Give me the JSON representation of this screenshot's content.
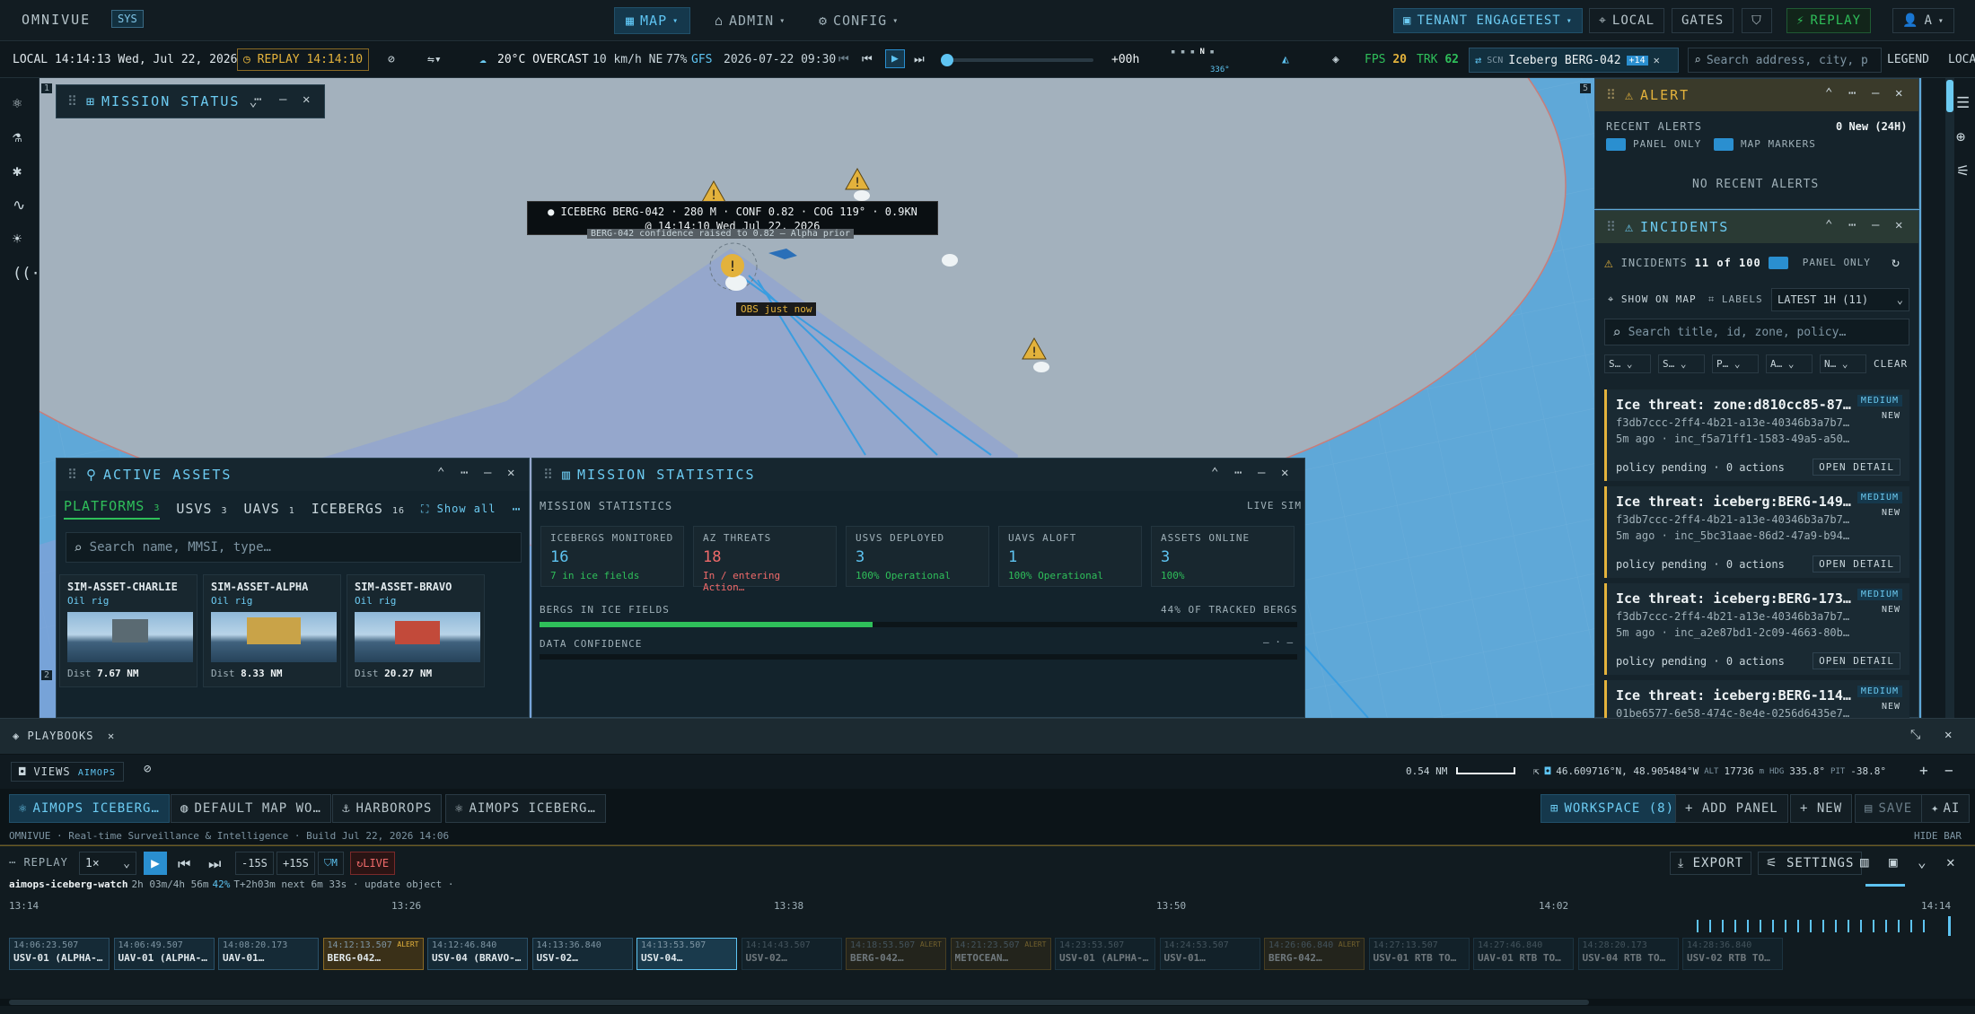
{
  "brand": "OMNIVUE",
  "sys_badge": "SYS",
  "nav": {
    "tabs": [
      "MAP",
      "ADMIN",
      "CONFIG"
    ],
    "tenant": "TENANT ENGAGETEST",
    "local": "LOCAL",
    "gates": "GATES",
    "replay": "REPLAY",
    "user": "A"
  },
  "toolbar": {
    "local_time": "LOCAL 14:14:13 Wed, Jul 22, 2026",
    "replay_time": "REPLAY 14:14:10",
    "weather": "20°C OVERCAST",
    "wind": "10 km/h NE",
    "humidity": "77%",
    "gfs": "GFS",
    "gfs_time": "2026-07-22 09:30",
    "offset": "+00h",
    "compass": {
      "n": "N",
      "deg": "336°"
    },
    "fps_label": "FPS",
    "fps": "20",
    "trk_label": "TRK",
    "trk": "62",
    "scn_label": "SCN",
    "scn": "Iceberg BERG-042",
    "scn_more": "+14",
    "search_placeholder": "Search address, city, p",
    "legend": "LEGEND",
    "loc": "LOCA"
  },
  "map": {
    "tooltip_line1": "● ICEBERG BERG-042 · 280 M · CONF 0.82 · COG 119° · 0.9KN",
    "tooltip_line2": "@ 14:14:10 Wed Jul 22, 2026",
    "note": "BERG-042 confidence raised to 0.82 — Alpha prior",
    "obs": "OBS just now",
    "scale_label": "0.54 NM",
    "coords": "46.609716°N, 48.905484°W",
    "alt_label": "ALT",
    "alt": "17736",
    "alt_unit": "m",
    "hdg_label": "HDG",
    "hdg": "335.8°",
    "pit_label": "PIT",
    "pit": "-38.8°",
    "views": "VIEWS",
    "aimops": "AIMOPS",
    "corner_left_top": "1",
    "corner_left_bottom": "2",
    "corner_right_top": "5"
  },
  "mission_status": {
    "title": "MISSION STATUS"
  },
  "assets": {
    "title": "ACTIVE ASSETS",
    "tabs": [
      {
        "label": "PLATFORMS",
        "count": "3"
      },
      {
        "label": "USVS",
        "count": "3"
      },
      {
        "label": "UAVS",
        "count": "1"
      },
      {
        "label": "ICEBERGS",
        "count": "16"
      }
    ],
    "show_all": "Show all",
    "search_placeholder": "Search name, MMSI, type…",
    "cards": [
      {
        "name": "SIM-ASSET-CHARLIE",
        "type": "Oil rig",
        "dist_label": "Dist",
        "dist": "7.67 NM"
      },
      {
        "name": "SIM-ASSET-ALPHA",
        "type": "Oil rig",
        "dist_label": "Dist",
        "dist": "8.33 NM"
      },
      {
        "name": "SIM-ASSET-BRAVO",
        "type": "Oil rig",
        "dist_label": "Dist",
        "dist": "20.27 NM"
      }
    ]
  },
  "stats": {
    "title": "MISSION STATISTICS",
    "section": "MISSION STATISTICS",
    "live": "LIVE SIM",
    "cards": [
      {
        "label": "ICEBERGS MONITORED",
        "value": "16",
        "sub": "7 in ice fields",
        "color": "#5ec4f2",
        "subcolor": "#2fbf5a"
      },
      {
        "label": "AZ THREATS",
        "value": "18",
        "sub": "In / entering Action…",
        "color": "#f06a6a",
        "subcolor": "#f06a6a"
      },
      {
        "label": "USVS DEPLOYED",
        "value": "3",
        "sub": "100% Operational",
        "color": "#5ec4f2",
        "subcolor": "#2fbf5a"
      },
      {
        "label": "UAVS ALOFT",
        "value": "1",
        "sub": "100% Operational",
        "color": "#5ec4f2",
        "subcolor": "#2fbf5a"
      },
      {
        "label": "ASSETS ONLINE",
        "value": "3",
        "sub": "100%",
        "color": "#5ec4f2",
        "subcolor": "#2fbf5a"
      }
    ],
    "bergs_label": "BERGS IN ICE FIELDS",
    "bergs_pct_text": "44% OF TRACKED BERGS",
    "bergs_fraction": 0.44,
    "confidence_label": "DATA CONFIDENCE",
    "confidence_value": "— · —"
  },
  "alert": {
    "title": "ALERT",
    "recent": "RECENT ALERTS",
    "new_count": "0 New (24H)",
    "panel_only": "PANEL ONLY",
    "map_markers": "MAP MARKERS",
    "empty": "NO RECENT ALERTS"
  },
  "incidents": {
    "title": "INCIDENTS",
    "label": "INCIDENTS",
    "count": "11 of 100",
    "panel_only": "PANEL ONLY",
    "show_on_map": "SHOW ON MAP",
    "labels": "LABELS",
    "range": "LATEST 1H (11)",
    "search_placeholder": "Search title, id, zone, policy…",
    "filters": [
      "S…",
      "S…",
      "P…",
      "A…",
      "N…"
    ],
    "clear": "CLEAR",
    "items": [
      {
        "title": "Ice threat: zone:d810cc85-87…",
        "id": "f3db7ccc-2ff4-4b21-a13e-40346b3a7b7…",
        "meta": "5m ago · inc_f5a71ff1-1583-49a5-a50…",
        "policy": "policy pending · 0 actions",
        "sev": "MEDIUM",
        "new": "NEW",
        "open": "OPEN DETAIL"
      },
      {
        "title": "Ice threat: iceberg:BERG-149…",
        "id": "f3db7ccc-2ff4-4b21-a13e-40346b3a7b7…",
        "meta": "5m ago · inc_5bc31aae-86d2-47a9-b94…",
        "policy": "policy pending · 0 actions",
        "sev": "MEDIUM",
        "new": "NEW",
        "open": "OPEN DETAIL"
      },
      {
        "title": "Ice threat: iceberg:BERG-173…",
        "id": "f3db7ccc-2ff4-4b21-a13e-40346b3a7b7…",
        "meta": "5m ago · inc_a2e87bd1-2c09-4663-80b…",
        "policy": "policy pending · 0 actions",
        "sev": "MEDIUM",
        "new": "NEW",
        "open": "OPEN DETAIL"
      },
      {
        "title": "Ice threat: iceberg:BERG-114…",
        "id": "01be6577-6e58-474c-8e4e-0256d6435e7…",
        "meta": "",
        "policy": "",
        "sev": "MEDIUM",
        "new": "NEW",
        "open": ""
      }
    ]
  },
  "playbooks": {
    "title": "PLAYBOOKS"
  },
  "workspace": {
    "tabs": [
      "AIMOPS ICEBERG…",
      "DEFAULT MAP WO…",
      "HARBOROPS",
      "AIMOPS ICEBERG…"
    ],
    "workspace": "WORKSPACE (8)",
    "add_panel": "+ ADD PANEL",
    "new": "+ NEW",
    "save": "SAVE",
    "ai": "AI"
  },
  "status": {
    "left": "OMNIVUE · Real-time Surveillance & Intelligence · Build Jul 22, 2026 14:06",
    "hide": "HIDE BAR"
  },
  "replay": {
    "label": "REPLAY",
    "speed": "1×",
    "back": "-15S",
    "fwd": "+15S",
    "mode": "M",
    "live": "LIVE",
    "export": "EXPORT",
    "settings": "SETTINGS",
    "name": "aimops-iceberg-watch",
    "info": "2h 03m/4h 56m",
    "pct": "42%",
    "info2": "T+2h03m next 6m 33s · update object ·",
    "progress": 0.42,
    "ticks": [
      "13:14",
      "13:26",
      "13:38",
      "13:50",
      "14:02",
      "14:14"
    ]
  },
  "events": [
    {
      "time": "14:06:23.507",
      "name": "USV-01 (ALPHA-…",
      "alert": false,
      "fade": false
    },
    {
      "time": "14:06:49.507",
      "name": "UAV-01 (ALPHA-…",
      "alert": false,
      "fade": false
    },
    {
      "time": "14:08:20.173",
      "name": "UAV-01…",
      "alert": false,
      "fade": false
    },
    {
      "time": "14:12:13.507",
      "name": "BERG-042…",
      "alert": true,
      "fade": false
    },
    {
      "time": "14:12:46.840",
      "name": "USV-04 (BRAVO-…",
      "alert": false,
      "fade": false
    },
    {
      "time": "14:13:36.840",
      "name": "USV-02…",
      "alert": false,
      "fade": false
    },
    {
      "time": "14:13:53.507",
      "name": "USV-04…",
      "alert": false,
      "fade": false
    },
    {
      "time": "14:14:43.507",
      "name": "USV-02…",
      "alert": false,
      "fade": true
    },
    {
      "time": "14:18:53.507",
      "name": "BERG-042…",
      "alert": true,
      "fade": true
    },
    {
      "time": "14:21:23.507",
      "name": "METOCEAN…",
      "alert": true,
      "fade": true
    },
    {
      "time": "14:23:53.507",
      "name": "USV-01 (ALPHA-…",
      "alert": false,
      "fade": true
    },
    {
      "time": "14:24:53.507",
      "name": "USV-01…",
      "alert": false,
      "fade": true
    },
    {
      "time": "14:26:06.840",
      "name": "BERG-042…",
      "alert": true,
      "fade": true
    },
    {
      "time": "14:27:13.507",
      "name": "USV-01 RTB TO…",
      "alert": false,
      "fade": true
    },
    {
      "time": "14:27:46.840",
      "name": "UAV-01 RTB TO…",
      "alert": false,
      "fade": true
    },
    {
      "time": "14:28:20.173",
      "name": "USV-04 RTB TO…",
      "alert": false,
      "fade": true
    },
    {
      "time": "14:28:36.840",
      "name": "USV-02 RTB TO…",
      "alert": false,
      "fade": true
    }
  ],
  "alert_tag": "ALERT",
  "colors": {
    "accent": "#5ec4f2",
    "alert": "#e3b23c",
    "ok": "#2fbf5a",
    "danger": "#f06a6a"
  }
}
